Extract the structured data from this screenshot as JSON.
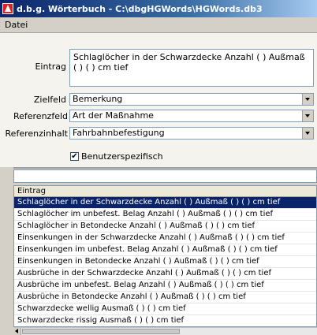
{
  "window": {
    "title": "d.b.g. Wörterbuch - C:\\dbgHGWords\\HGWords.db3"
  },
  "menu": {
    "items": [
      "Datei"
    ]
  },
  "form": {
    "eintrag_label": "Eintrag",
    "eintrag_value": "Schlaglöcher in der Schwarzdecke Anzahl ( ) Außmaß ( ) ( ) cm tief",
    "zielfeld_label": "Zielfeld",
    "zielfeld_value": "Bemerkung",
    "referenzfeld_label": "Referenzfeld",
    "referenzfeld_value": "Art der Maßnahme",
    "referenzinhalt_label": "Referenzinhalt",
    "referenzinhalt_value": "Fahrbahnbefestigung",
    "benutzer_label": "Benutzerspezifisch",
    "benutzer_checked": "✔"
  },
  "grid": {
    "header": "Eintrag",
    "rows": [
      "Schlaglöcher in der Schwarzdecke Anzahl ( ) Außmaß ( ) ( ) cm tief",
      "Schlaglöcher im unbefest. Belag Anzahl ( ) Außmaß ( ) ( ) cm tief",
      "Schlaglöcher in Betondecke Anzahl ( ) Außmaß ( ) ( ) cm tief",
      "Einsenkungen in der Schwarzdecke Anzahl ( ) Außmaß ( ) ( ) cm tief",
      "Einsenkungen im unbefest. Belag Anzahl ( ) Außmaß ( ) ( ) cm tief",
      "Einsenkungen in Betondecke Anzahl ( ) Außmaß ( ) ( ) cm tief",
      "Ausbrüche in der Schwarzdecke Anzahl ( ) Außmaß ( ) ( ) cm tief",
      "Ausbrüche im unbefest. Belag Anzahl ( ) Außmaß ( ) ( ) cm tief",
      "Ausbrüche in Betondecke Anzahl ( ) Außmaß ( ) ( ) cm tief",
      "Schwarzdecke wellig Ausmaß ( ) ( ) cm tief",
      "Schwarzdecke rissig Ausmaß ( ) ( ) cm tief"
    ]
  }
}
